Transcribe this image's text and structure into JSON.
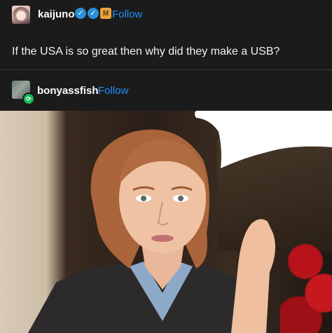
{
  "post": {
    "username": "kaijuno",
    "badge_check_1": "✓",
    "badge_check_2": "✓",
    "badge_extra": "M",
    "follow_label": "Follow",
    "text": "If the USA is so great then why did they make a USB?"
  },
  "reblog": {
    "username": "bonyassfish",
    "follow_label": "Follow",
    "reblog_glyph": "⟳"
  },
  "icons": {
    "verified": "verified-badge-icon",
    "reblog": "reblog-icon"
  },
  "colors": {
    "background": "#1b1b1b",
    "link": "#1e90ff",
    "verified": "#2b8fd9",
    "reblog": "#1ab85a"
  }
}
